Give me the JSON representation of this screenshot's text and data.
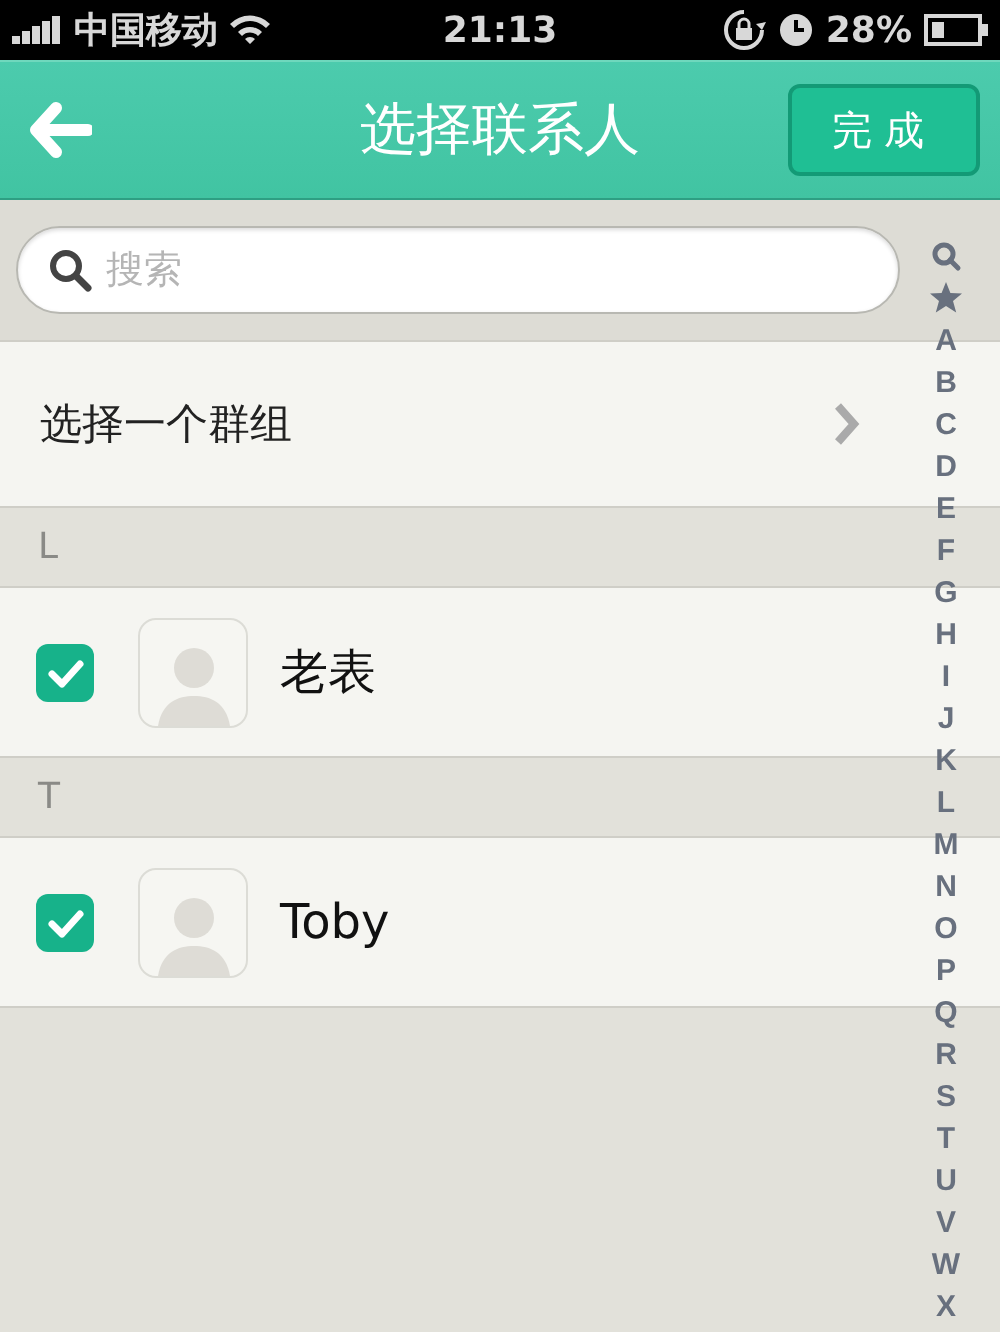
{
  "status_bar": {
    "carrier": "中国移动",
    "time": "21:13",
    "battery": "28%"
  },
  "header": {
    "title": "选择联系人",
    "done_button": "完成"
  },
  "search": {
    "placeholder": "搜索"
  },
  "group_row": {
    "label": "选择一个群组"
  },
  "sections": [
    {
      "letter": "L",
      "contacts": [
        {
          "name": "老表",
          "checked": true
        }
      ]
    },
    {
      "letter": "T",
      "contacts": [
        {
          "name": "Toby",
          "checked": true
        }
      ]
    }
  ],
  "index": [
    "A",
    "B",
    "C",
    "D",
    "E",
    "F",
    "G",
    "H",
    "I",
    "J",
    "K",
    "L",
    "M",
    "N",
    "O",
    "P",
    "Q",
    "R",
    "S",
    "T",
    "U",
    "V",
    "W",
    "X"
  ]
}
